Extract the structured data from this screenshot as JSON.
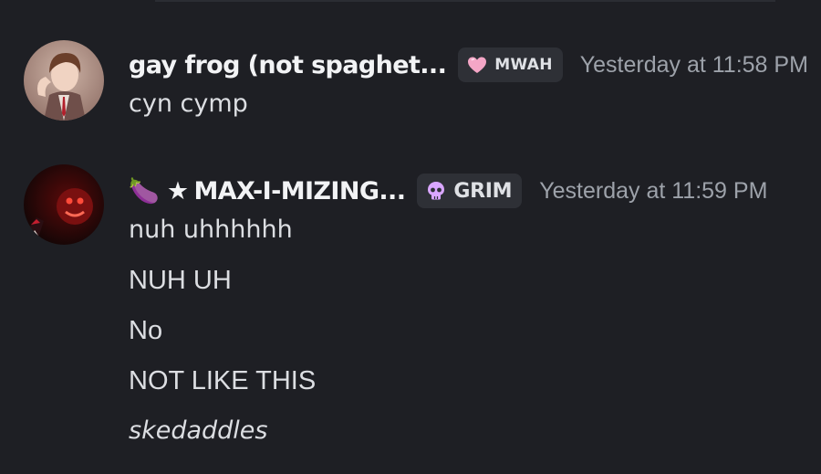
{
  "messages": [
    {
      "username": "gay frog (not spaghet...",
      "tag": {
        "label": "MWAH",
        "icon": "pink-heart-icon"
      },
      "timestamp": "Yesterday at 11:58 PM",
      "lines": [
        "cyn cymp"
      ]
    },
    {
      "username_emoji": "🍆",
      "username_star": "★",
      "username": "MAX-I-MIZING...",
      "tag": {
        "label": "GRIM",
        "icon": "pink-skull-icon"
      },
      "timestamp": "Yesterday at 11:59 PM",
      "lines": [
        "nuh uhhhhhh",
        "NUH UH",
        "No",
        "NOT LIKE THIS",
        "skedaddles"
      ]
    }
  ],
  "colors": {
    "background": "#1e1f24",
    "username": "#f2f3f5",
    "timestamp": "#9da2aa",
    "tag_background": "#2e3036",
    "heart": "#f4a6c6",
    "skull": "#d9a6ff"
  }
}
